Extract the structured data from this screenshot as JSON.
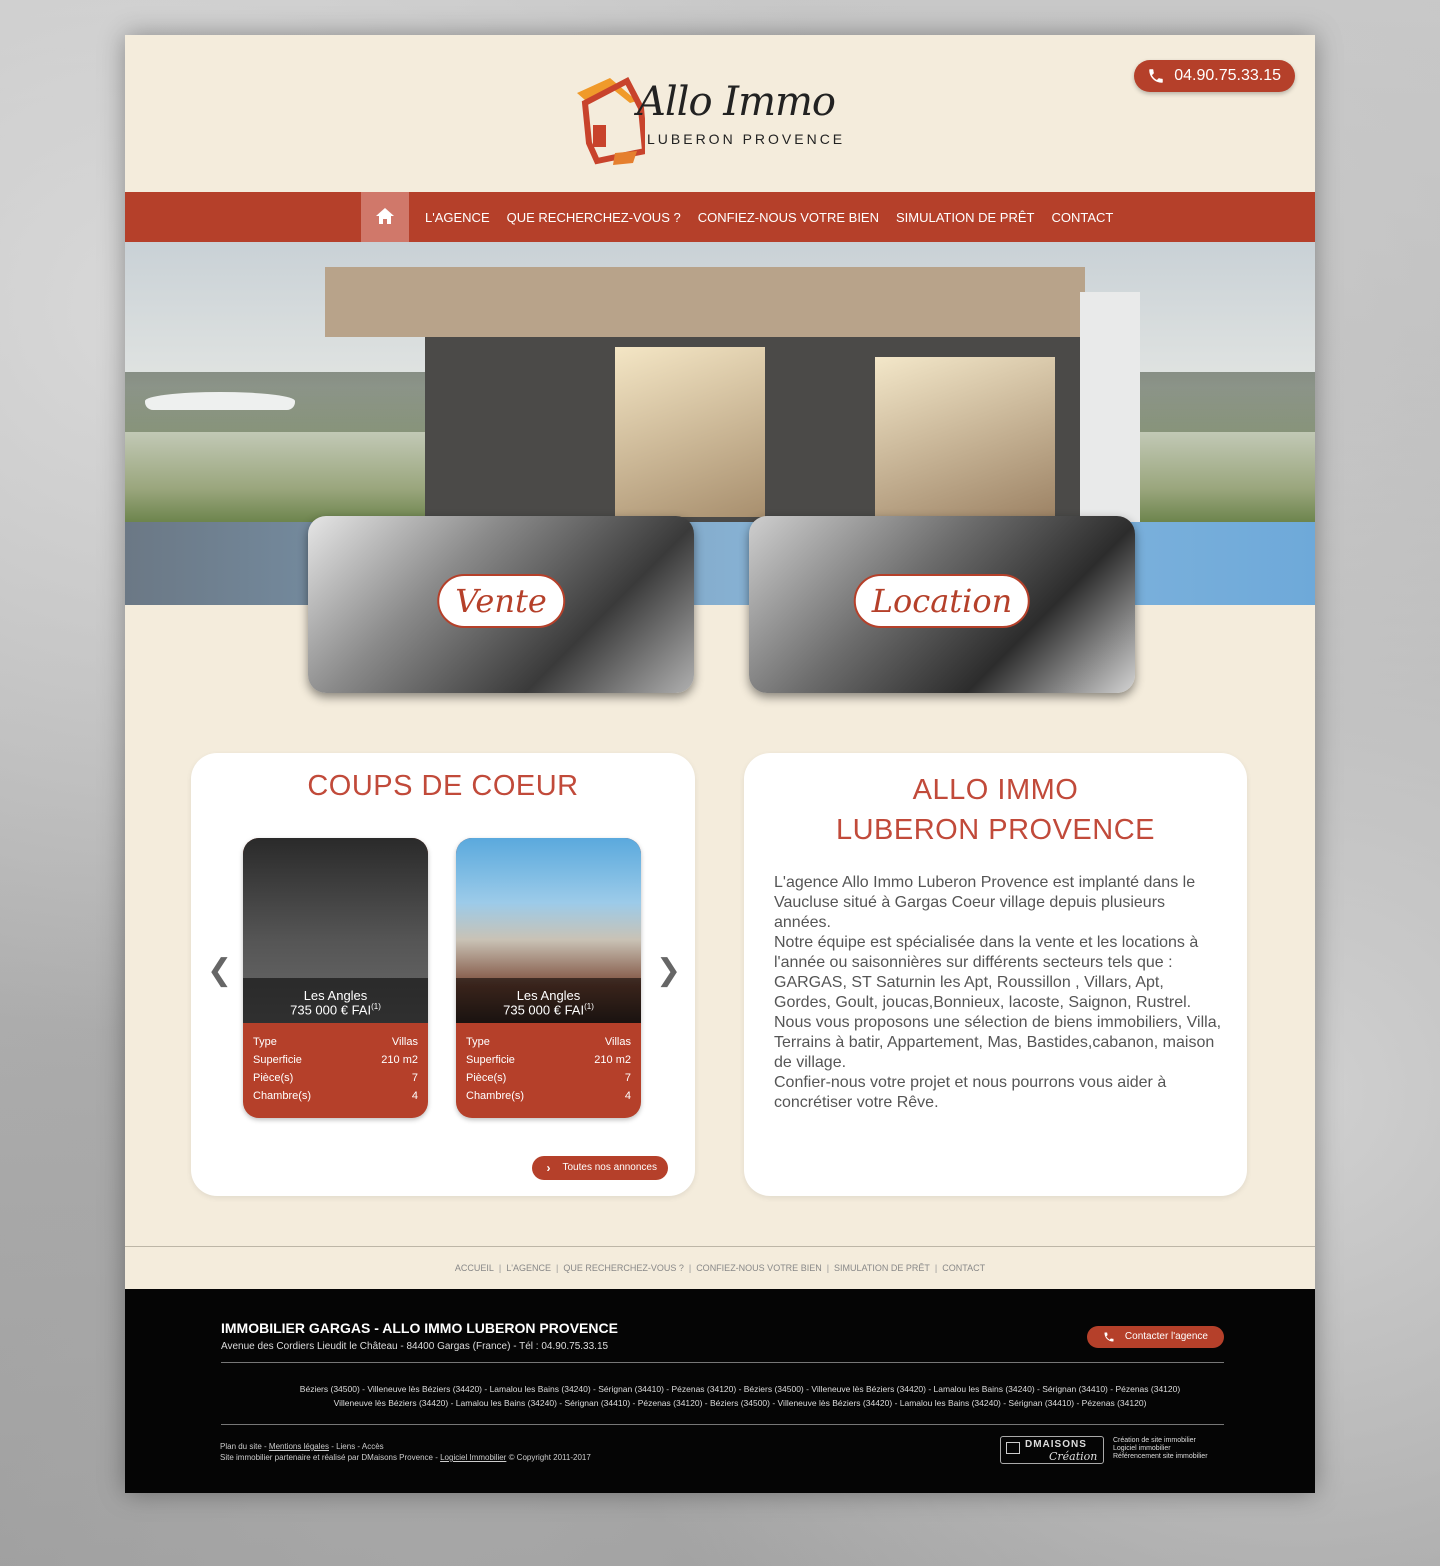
{
  "header": {
    "logo_title": "Allo Immo",
    "logo_subtitle": "LUBERON PROVENCE",
    "phone": "04.90.75.33.15"
  },
  "nav": {
    "items": [
      {
        "label": "L'AGENCE"
      },
      {
        "label": "QUE RECHERCHEZ-VOUS ?"
      },
      {
        "label": "CONFIEZ-NOUS VOTRE BIEN"
      },
      {
        "label": "SIMULATION DE PRÊT"
      },
      {
        "label": "CONTACT"
      }
    ]
  },
  "categories": {
    "vente": "Vente",
    "location": "Location"
  },
  "coups_de_coeur": {
    "title": "COUPS DE COEUR",
    "prev": "❮",
    "next": "❯",
    "properties": [
      {
        "location": "Les Angles",
        "price": "735 000 € FAI",
        "price_note": "(1)",
        "rows": [
          {
            "label": "Type",
            "value": "Villas"
          },
          {
            "label": "Superficie",
            "value": "210 m2"
          },
          {
            "label": "Pièce(s)",
            "value": "7"
          },
          {
            "label": "Chambre(s)",
            "value": "4"
          }
        ]
      },
      {
        "location": "Les Angles",
        "price": "735 000 € FAI",
        "price_note": "(1)",
        "rows": [
          {
            "label": "Type",
            "value": "Villas"
          },
          {
            "label": "Superficie",
            "value": "210 m2"
          },
          {
            "label": "Pièce(s)",
            "value": "7"
          },
          {
            "label": "Chambre(s)",
            "value": "4"
          }
        ]
      }
    ],
    "all_button": "Toutes nos annonces"
  },
  "agency": {
    "title_line1": "ALLO IMMO",
    "title_line2": "LUBERON PROVENCE",
    "paragraphs": [
      "L'agence Allo Immo Luberon Provence est implanté dans le Vaucluse situé à Gargas Coeur village depuis plusieurs années.",
      "Notre équipe est spécialisée dans la vente et les locations à l'année ou saisonnières sur différents secteurs tels que : GARGAS, ST Saturnin les Apt, Roussillon , Villars, Apt, Gordes, Goult, joucas,Bonnieux, lacoste, Saignon, Rustrel.",
      "Nous vous proposons une sélection de biens immobiliers, Villa, Terrains à batir, Appartement, Mas, Bastides,cabanon, maison de village.",
      "Confier-nous votre projet et nous pourrons vous aider à concrétiser votre Rêve."
    ]
  },
  "footer_links": {
    "items": [
      "ACCUEIL",
      "L'AGENCE",
      "QUE RECHERCHEZ-VOUS ?",
      "CONFIEZ-NOUS VOTRE BIEN",
      "SIMULATION DE PRÊT",
      "CONTACT"
    ],
    "separator": "|"
  },
  "footer": {
    "title": "IMMOBILIER GARGAS  - ALLO IMMO LUBERON PROVENCE",
    "address": "Avenue des Cordiers Lieudit le Château - 84400 Gargas (France) - Tél : 04.90.75.33.15",
    "contact_button": "Contacter l'agence",
    "cities_line1": "Béziers (34500) - Villeneuve lès Béziers (34420) - Lamalou les Bains (34240) - Sérignan (34410) - Pézenas (34120) - Béziers (34500) - Villeneuve lès Béziers (34420) - Lamalou les Bains (34240) - Sérignan (34410) - Pézenas (34120)",
    "cities_line2": "Villeneuve lès Béziers (34420) - Lamalou les Bains (34240) - Sérignan (34410) - Pézenas (34120) - Béziers (34500) - Villeneuve lès Béziers (34420) - Lamalou les Bains (34240) - Sérignan (34410) - Pézenas (34120)",
    "plan": "Plan du site",
    "mentions": "Mentions légales",
    "liens": "Liens",
    "acces": "Accès",
    "partner_prefix": "Site immobilier partenaire et réalisé par DMaisons Provence - ",
    "logiciel": "Logiciel Immobilier",
    "copyright": " © Copyright 2011-2017",
    "dm_brand": "DMAISONS",
    "dm_creation": "Création",
    "dm_text1": "Création de site immobilier",
    "dm_text2": "Logiciel immobilier",
    "dm_text3": "Référencement site immobilier"
  }
}
